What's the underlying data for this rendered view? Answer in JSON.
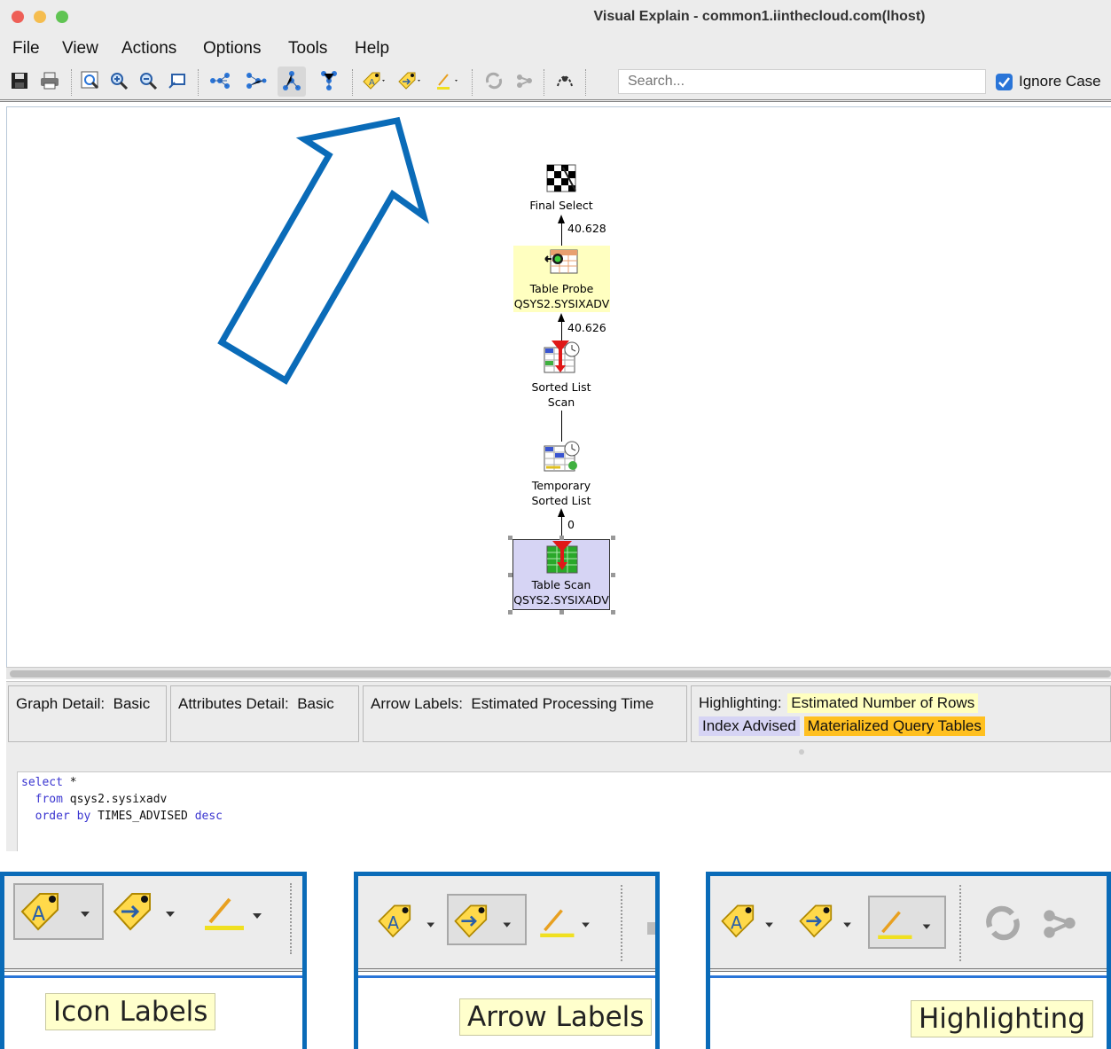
{
  "window": {
    "title": "Visual Explain - common1.iinthecloud.com(lhost)"
  },
  "menu": {
    "items": [
      "File",
      "View",
      "Actions",
      "Options",
      "Tools",
      "Help"
    ]
  },
  "toolbar": {
    "search_placeholder": "Search...",
    "ignore_case_label": "Ignore Case",
    "ignore_case_checked": true,
    "icons": [
      "save-icon",
      "print-icon",
      "zoom-fit-icon",
      "zoom-in-icon",
      "zoom-out-icon",
      "overview-icon",
      "layout-horizontal-icon",
      "layout-vertical-icon",
      "layout-tree-icon",
      "layout-hierarchy-icon",
      "icon-labels-icon",
      "arrow-labels-icon",
      "highlighting-icon",
      "refresh-icon",
      "compare-icon",
      "settings-icon"
    ]
  },
  "graph": {
    "nodes": [
      {
        "id": "final-select",
        "label_lines": [
          "Final Select"
        ]
      },
      {
        "id": "table-probe",
        "label_lines": [
          "Table Probe",
          "QSYS2.SYSIXADV"
        ],
        "highlight": "#ffffc0"
      },
      {
        "id": "sorted-list-scan",
        "label_lines": [
          "Sorted List",
          "Scan"
        ]
      },
      {
        "id": "temporary-sorted-list",
        "label_lines": [
          "Temporary",
          "Sorted List"
        ]
      },
      {
        "id": "table-scan",
        "label_lines": [
          "Table Scan",
          "QSYS2.SYSIXADV"
        ],
        "highlight": "#d6d4f4",
        "selected": true
      }
    ],
    "edges": [
      {
        "from": "table-probe",
        "to": "final-select",
        "label": "40.628"
      },
      {
        "from": "sorted-list-scan",
        "to": "table-probe",
        "label": "40.626"
      },
      {
        "from": "temporary-sorted-list",
        "to": "sorted-list-scan",
        "label": ""
      },
      {
        "from": "table-scan",
        "to": "temporary-sorted-list",
        "label": "0"
      }
    ]
  },
  "status": {
    "graph_detail_label": "Graph Detail:",
    "graph_detail_value": "Basic",
    "attributes_detail_label": "Attributes Detail:",
    "attributes_detail_value": "Basic",
    "arrow_labels_label": "Arrow Labels:",
    "arrow_labels_value": "Estimated Processing Time",
    "highlighting_label": "Highlighting:",
    "highlighting_items": [
      {
        "label": "Estimated Number of Rows",
        "color": "#ffffc0"
      },
      {
        "label": "Index Advised",
        "color": "#d6d4f4"
      },
      {
        "label": "Materialized Query Tables",
        "color": "#ffc020"
      }
    ]
  },
  "sql": {
    "line1_kw": "select",
    "line1_rest": " *",
    "line2_kw": "from",
    "line2_rest": " qsys2.sysixadv",
    "line3_kw1": "order by",
    "line3_mid": " TIMES_ADVISED ",
    "line3_kw2": "desc"
  },
  "callouts": {
    "arrow_color": "#0a6bb8",
    "panels": [
      {
        "tooltip": "Icon Labels",
        "selected_button": "icon-labels"
      },
      {
        "tooltip": "Arrow Labels",
        "selected_button": "arrow-labels"
      },
      {
        "tooltip": "Highlighting",
        "selected_button": "highlighting"
      }
    ]
  }
}
